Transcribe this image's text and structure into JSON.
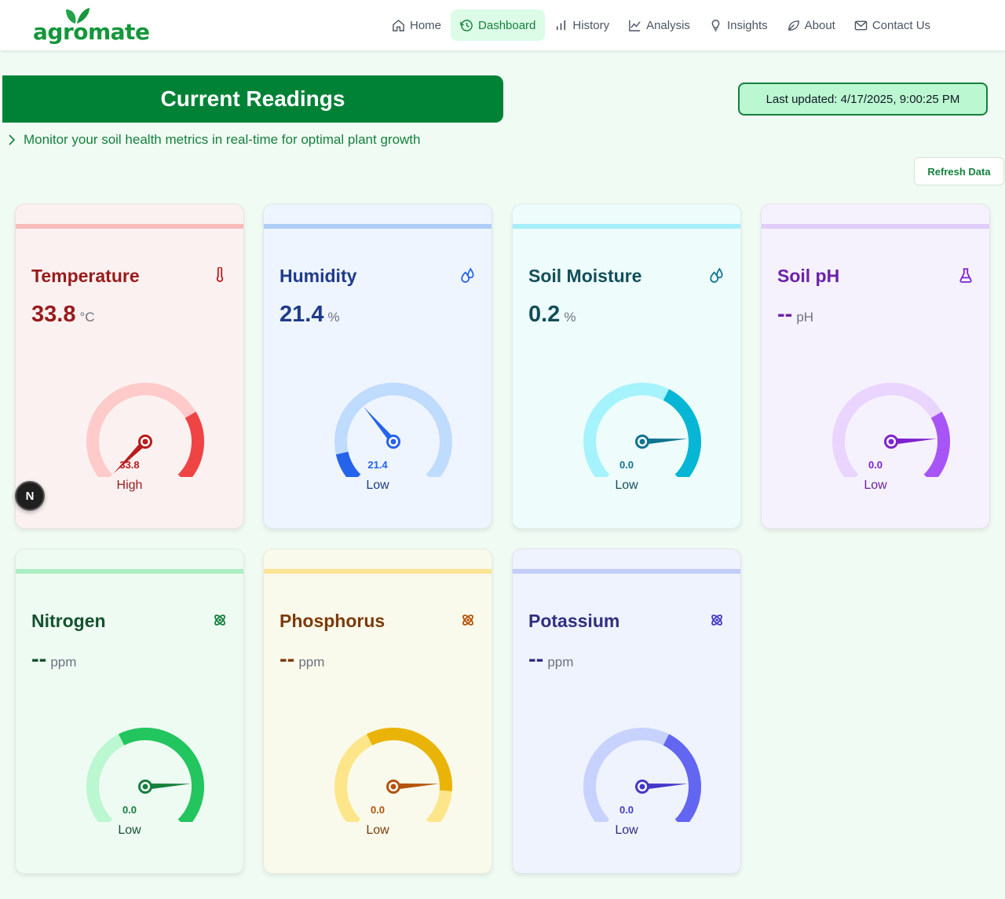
{
  "brand": {
    "logo_text": "agromate"
  },
  "nav": {
    "items": [
      {
        "label": "Home",
        "icon": "home-icon",
        "active": false
      },
      {
        "label": "Dashboard",
        "icon": "history-clock-icon",
        "active": true
      },
      {
        "label": "History",
        "icon": "bar-chart-icon",
        "active": false
      },
      {
        "label": "Analysis",
        "icon": "line-chart-icon",
        "active": false
      },
      {
        "label": "Insights",
        "icon": "lightbulb-icon",
        "active": false
      },
      {
        "label": "About",
        "icon": "leaf-icon",
        "active": false
      },
      {
        "label": "Contact Us",
        "icon": "mail-icon",
        "active": false
      }
    ]
  },
  "header": {
    "title": "Current Readings",
    "subtitle": "Monitor your soil health metrics in real-time for optimal plant growth",
    "last_updated": "Last updated: 4/17/2025, 9:00:25 PM",
    "refresh_label": "Refresh Data"
  },
  "cards": [
    {
      "name": "Temperature",
      "value": "33.8",
      "unit": "°C",
      "gauge_label": "33.8",
      "status": "High",
      "gauge_fraction": 0.0,
      "colors": {
        "bg": "#fbf1f1",
        "bar": "#fcbaba",
        "title": "#991b1b",
        "track": "#fecaca",
        "fill": "#ef4444",
        "needle": "#b91c1c"
      },
      "fill_start": 0.72,
      "fill_end": 1.0,
      "icon": "thermometer-icon"
    },
    {
      "name": "Humidity",
      "value": "21.4",
      "unit": "%",
      "gauge_label": "21.4",
      "status": "Low",
      "gauge_fraction": 0.35,
      "colors": {
        "bg": "#eef5fe",
        "bar": "#aecdf8",
        "title": "#1e3a8a",
        "track": "#bfdbfe",
        "fill": "#2563eb",
        "needle": "#2563eb"
      },
      "fill_start": 0.0,
      "fill_end": 0.12,
      "icon": "droplets-icon"
    },
    {
      "name": "Soil Moisture",
      "value": "0.2",
      "unit": "%",
      "gauge_label": "0.0",
      "status": "Low",
      "gauge_fraction": 0.82,
      "colors": {
        "bg": "#eefcfc",
        "bar": "#a5effa",
        "title": "#134e5a",
        "track": "#a5f3fc",
        "fill": "#06b6d4",
        "needle": "#0e7490"
      },
      "fill_start": 0.6,
      "fill_end": 1.0,
      "icon": "droplets-icon"
    },
    {
      "name": "Soil pH",
      "value": "--",
      "unit": "pH",
      "gauge_label": "0.0",
      "status": "Low",
      "gauge_fraction": 0.82,
      "colors": {
        "bg": "#f6f2fd",
        "bar": "#e1cdf9",
        "title": "#6b21a8",
        "track": "#e9d5ff",
        "fill": "#a855f7",
        "needle": "#7e22ce"
      },
      "fill_start": 0.72,
      "fill_end": 1.0,
      "icon": "flask-icon"
    },
    {
      "name": "Nitrogen",
      "value": "--",
      "unit": "ppm",
      "gauge_label": "0.0",
      "status": "Low",
      "gauge_fraction": 0.82,
      "colors": {
        "bg": "#eefbf3",
        "bar": "#aceec4",
        "title": "#14532d",
        "track": "#bbf7d0",
        "fill": "#22c55e",
        "needle": "#15803d"
      },
      "fill_start": 0.4,
      "fill_end": 1.0,
      "icon": "atom-icon"
    },
    {
      "name": "Phosphorus",
      "value": "--",
      "unit": "ppm",
      "gauge_label": "0.0",
      "status": "Low",
      "gauge_fraction": 0.82,
      "colors": {
        "bg": "#f9faeb",
        "bar": "#fde492",
        "title": "#7c3a0c",
        "track": "#fde68a",
        "fill": "#eab308",
        "needle": "#b45309"
      },
      "fill_start": 0.4,
      "fill_end": 0.85,
      "icon": "atom-icon"
    },
    {
      "name": "Potassium",
      "value": "--",
      "unit": "ppm",
      "gauge_label": "0.0",
      "status": "Low",
      "gauge_fraction": 0.82,
      "colors": {
        "bg": "#eff3fd",
        "bar": "#c2cdf8",
        "title": "#312e81",
        "track": "#c7d2fe",
        "fill": "#6366f1",
        "needle": "#4338ca"
      },
      "fill_start": 0.6,
      "fill_end": 1.0,
      "icon": "atom-icon"
    }
  ],
  "badge": {
    "label": "N"
  }
}
